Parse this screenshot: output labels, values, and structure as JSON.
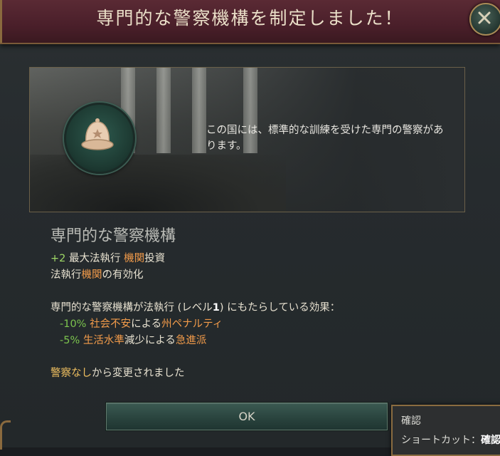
{
  "title": "専門的な警察機構を制定しました！",
  "description": "この国には、標準的な訓練を受けた専門の警察があります。",
  "heading": "専門的な警察機構",
  "effects": {
    "line1_value": "+2",
    "line1_text_a": " 最大法執行 ",
    "line1_text_b": "機関",
    "line1_text_c": "投資",
    "line2_text_a": "法執行",
    "line2_text_b": "機関",
    "line2_text_c": "の有効化"
  },
  "level_effects": {
    "intro_a": "専門的な警察機構が法執行 (レベル",
    "intro_level": "1",
    "intro_b": ") にもたらしている効果：",
    "item1_value": "-10%",
    "item1_a": " 社会不安",
    "item1_b": "による",
    "item1_c": "州ペナルティ",
    "item2_value": "-5%",
    "item2_a": " 生活水準",
    "item2_b": "減少による",
    "item2_c": "急進派"
  },
  "changed_from_a": "警察なし",
  "changed_from_b": "から変更されました",
  "ok_label": "OK",
  "tooltip": {
    "title": "確認",
    "shortcut_label": "ショートカット：",
    "shortcut_key": "確認"
  },
  "icons": {
    "close": "close-icon",
    "badge": "police-helmet-icon"
  },
  "colors": {
    "title_bar": "#4a1f2a",
    "positive": "#9fd866",
    "highlight": "#f29b4a",
    "ok_button": "#2a443e"
  }
}
